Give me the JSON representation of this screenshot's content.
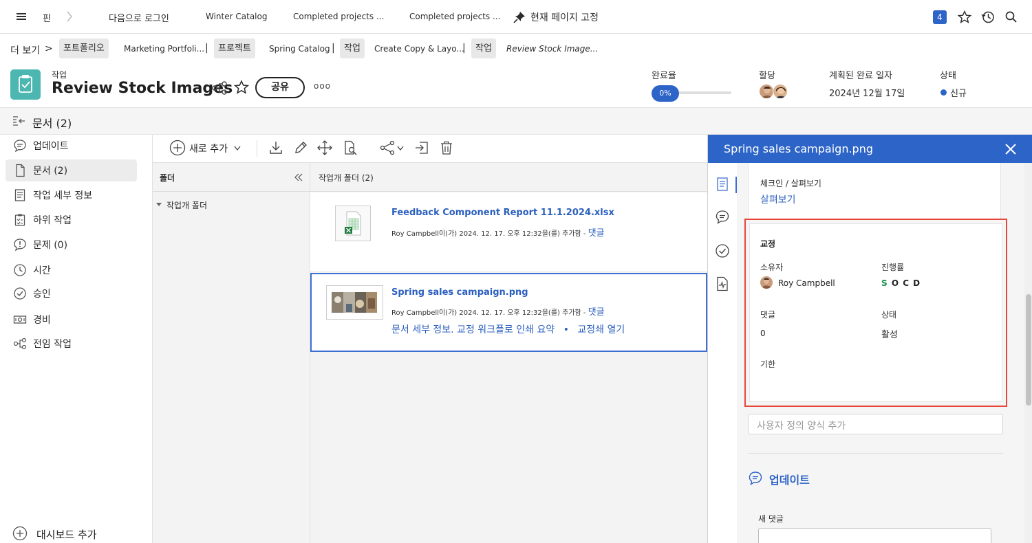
{
  "topbar": {
    "menu_icon": "hamburger-icon",
    "pin_label": "핀",
    "login_as": "다음으로 로그인",
    "tab1": "Winter Catalog",
    "tab2": "Completed projects ...",
    "tab3": "Completed projects ...",
    "pin_page": "현재 페이지 고정",
    "badge_count": "4"
  },
  "breadcrumb": {
    "more": "더 보기",
    "portfolio_chip": "포트폴리오",
    "portfolio_name": "Marketing Portfoli...",
    "project_chip": "프로젝트",
    "project_name": "Spring Catalog",
    "task_chip1": "작업",
    "task_name1": "Create Copy & Layo...",
    "task_chip2": "작업",
    "task_name2": "Review Stock Image..."
  },
  "header": {
    "type_label": "작업",
    "title": "Review Stock Images",
    "share_label": "공유",
    "more_label": "ooo",
    "completion_label": "완료율",
    "completion_value": "0%",
    "completion_fraction": 0.0,
    "assign_label": "할당",
    "planned_label": "계획된 완료 일자",
    "planned_value": "2024년 12월 17일",
    "status_label": "상태",
    "status_value": "신규",
    "status_color": "#2d64c8"
  },
  "docbar": {
    "title": "문서 (2)"
  },
  "sidebar": {
    "items": [
      {
        "label": "업데이트",
        "icon": "speech-bubble-icon"
      },
      {
        "label": "문서 (2)",
        "icon": "document-icon"
      },
      {
        "label": "작업 세부 정보",
        "icon": "details-icon"
      },
      {
        "label": "하위 작업",
        "icon": "subtask-icon"
      },
      {
        "label": "문제 (0)",
        "icon": "issue-icon"
      },
      {
        "label": "시간",
        "icon": "clock-icon"
      },
      {
        "label": "승인",
        "icon": "check-circle-icon"
      },
      {
        "label": "경비",
        "icon": "money-icon"
      },
      {
        "label": "전임 작업",
        "icon": "predecessor-icon"
      }
    ],
    "add_dashboard": "대시보드 추가"
  },
  "toolbar": {
    "add_new": "새로 추가"
  },
  "folders": {
    "header": "폴더",
    "item": "작업개 폴더"
  },
  "files": {
    "header": "작업개 폴더 (2)",
    "list": [
      {
        "name": "Feedback Component Report 11.1.2024.xlsx",
        "meta_user": "Roy Campbell",
        "meta_text": "이(가) 2024. 12. 17. 오후 12:32을(를) 추가함 -",
        "comment": "댓글"
      },
      {
        "name": "Spring sales campaign.png",
        "meta_user": "Roy Campbell",
        "meta_text": "이(가) 2024. 12. 17. 오후 12:32을(를) 추가함 -",
        "comment": "댓글",
        "links": "문서 세부 정보. 교정 워크플로 인쇄 요약",
        "open_proof": "교정쇄 열기"
      }
    ]
  },
  "rpanel": {
    "title": "Spring sales campaign.png",
    "checkin_label": "체크인 / 살펴보기",
    "preview_link": "살펴보기",
    "proof_title": "교정",
    "owner_label": "소유자",
    "owner_name": "Roy Campbell",
    "progress_label": "진행률",
    "progress_value": "S O C D",
    "comments_label": "댓글",
    "comments_value": "0",
    "status_label": "상태",
    "status_value": "활성",
    "due_label": "기한",
    "custom_form_placeholder": "사용자 정의 양식 추가",
    "updates_title": "업데이트",
    "new_comment": "새 댓글"
  }
}
